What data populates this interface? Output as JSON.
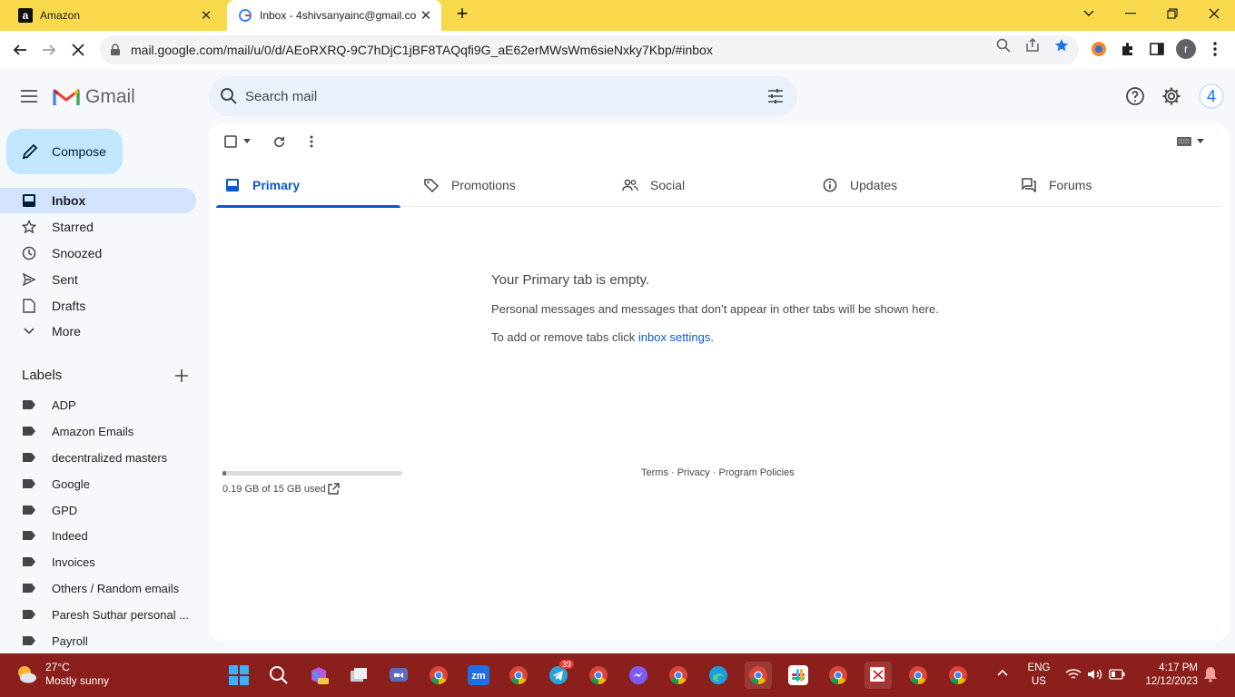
{
  "browser": {
    "tabs": [
      {
        "title": "Amazon",
        "favicon": "amazon-icon"
      },
      {
        "title": "Inbox - 4shivsanyainc@gmail.co",
        "favicon": "gmail-icon"
      }
    ],
    "url": "mail.google.com/mail/u/0/d/AEoRXRQ-9C7hDjC1jBF8TAQqfi9G_aE62erMWsWm6sieNxky7Kbp/#inbox",
    "profile_initial": "r",
    "tabstrip_color": "#f8d94b"
  },
  "gmail": {
    "app_name": "Gmail",
    "search_placeholder": "Search mail",
    "account_initial": "4",
    "compose_label": "Compose",
    "nav": [
      {
        "label": "Inbox",
        "icon": "inbox-icon",
        "active": true
      },
      {
        "label": "Starred",
        "icon": "star-icon"
      },
      {
        "label": "Snoozed",
        "icon": "clock-icon"
      },
      {
        "label": "Sent",
        "icon": "send-icon"
      },
      {
        "label": "Drafts",
        "icon": "draft-icon"
      },
      {
        "label": "More",
        "icon": "chevron-down-icon"
      }
    ],
    "labels_title": "Labels",
    "labels": [
      "ADP",
      "Amazon Emails",
      "decentralized masters",
      "Google",
      "GPD",
      "Indeed",
      "Invoices",
      "Others / Random emails",
      "Paresh Suthar personal ...",
      "Payroll"
    ],
    "tabs": [
      {
        "label": "Primary",
        "icon": "inbox-tab-icon",
        "active": true
      },
      {
        "label": "Promotions",
        "icon": "tag-icon"
      },
      {
        "label": "Social",
        "icon": "people-icon"
      },
      {
        "label": "Updates",
        "icon": "info-icon"
      },
      {
        "label": "Forums",
        "icon": "forum-icon"
      }
    ],
    "empty_title": "Your Primary tab is empty.",
    "empty_line1": "Personal messages and messages that don’t appear in other tabs will be shown here.",
    "empty_line2_prefix": "To add or remove tabs click ",
    "empty_line2_link": "inbox settings",
    "empty_line2_suffix": ".",
    "storage_text": "0.19 GB of 15 GB used",
    "storage_fraction": 0.013,
    "footer": "Terms · Privacy · Program Policies",
    "accent_color": "#0b57d0"
  },
  "taskbar": {
    "temperature": "27°C",
    "condition": "Mostly sunny",
    "lang_line1": "ENG",
    "lang_line2": "US",
    "time": "4:17 PM",
    "date": "12/12/2023",
    "telegram_badge": "39",
    "color": "#8b1f1b"
  }
}
